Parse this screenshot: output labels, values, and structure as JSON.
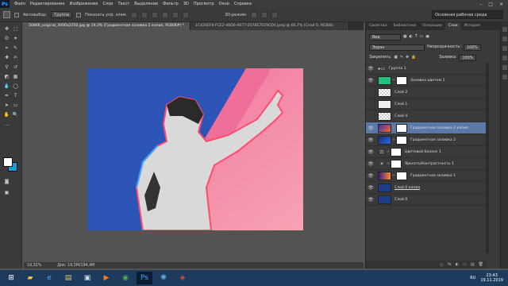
{
  "app": {
    "logo": "Ps"
  },
  "menu": [
    "Файл",
    "Редактирование",
    "Изображение",
    "Слои",
    "Текст",
    "Выделение",
    "Фильтр",
    "3D",
    "Просмотр",
    "Окно",
    "Справка"
  ],
  "window_buttons": [
    "–",
    "□",
    "✕"
  ],
  "options": {
    "autoselect_label": "Автовыбор:",
    "autoselect_value": "Группа",
    "show_controls_label": "Показать упр. элем.",
    "mode3d_label": "3D-режим:",
    "workspace": "Основная рабочая среда"
  },
  "tabs": [
    {
      "label": "50866_original_3000x2250.jpg @ 19,3% (Градиентная заливка 2 копия, RGB/8#) *",
      "active": true
    },
    {
      "label": "1C426EF9-FCE2-46D6-A077-2578E7EE9CD4.jpeg @ 66,7% (Слой 0, RGB/8)",
      "active": false
    }
  ],
  "status": {
    "zoom": "19,32%",
    "doc": "Док: 19,3M/194,4M"
  },
  "panel_tabs": [
    {
      "label": "Свойства",
      "active": false
    },
    {
      "label": "Библиотеки",
      "active": false
    },
    {
      "label": "Операции",
      "active": false
    },
    {
      "label": "Слои",
      "active": true
    },
    {
      "label": "История",
      "active": false
    }
  ],
  "layers_panel": {
    "kind": "Вид",
    "blend_mode": "Экран",
    "opacity_label": "Непрозрачность:",
    "opacity_value": "100%",
    "lock_label": "Закрепить:",
    "fill_label": "Заливка:",
    "fill_value": "100%"
  },
  "layers": [
    {
      "name": "Группа 1",
      "type": "group",
      "visible": true,
      "selected": false
    },
    {
      "name": "Заливка цветом 1",
      "type": "fill",
      "visible": true,
      "selected": false,
      "color": "#22c07a"
    },
    {
      "name": "Слой 2",
      "type": "layer",
      "visible": false,
      "selected": false
    },
    {
      "name": "Слой 1",
      "type": "layer",
      "visible": false,
      "selected": false
    },
    {
      "name": "Слой 4",
      "type": "layer",
      "visible": false,
      "selected": false
    },
    {
      "name": "Градиентная заливка 2 копия",
      "type": "gradient",
      "visible": true,
      "selected": true
    },
    {
      "name": "Градиентная заливка 2",
      "type": "gradient2",
      "visible": true,
      "selected": false
    },
    {
      "name": "Цветовой баланс 1",
      "type": "adjust",
      "visible": true,
      "selected": false
    },
    {
      "name": "Яркость/Контрастность 1",
      "type": "adjust2",
      "visible": true,
      "selected": false
    },
    {
      "name": "Градиентная заливка 1",
      "type": "gradient3",
      "visible": true,
      "selected": false
    },
    {
      "name": "Слой 0 копия",
      "type": "photo",
      "visible": true,
      "selected": false
    },
    {
      "name": "Слой 0",
      "type": "photo",
      "visible": true,
      "selected": false
    }
  ],
  "panel_footer": [
    "ⓞ",
    "fx",
    "◐",
    "▭",
    "▤",
    "🗑"
  ],
  "colors": {
    "foreground": "#ffffff",
    "background": "#1b9ad6",
    "canvas_blue": "#2d55b8",
    "canvas_pink": "#f27ba0"
  },
  "taskbar": {
    "lang": "RU",
    "time": "23:43",
    "date": "19.11.2019"
  }
}
